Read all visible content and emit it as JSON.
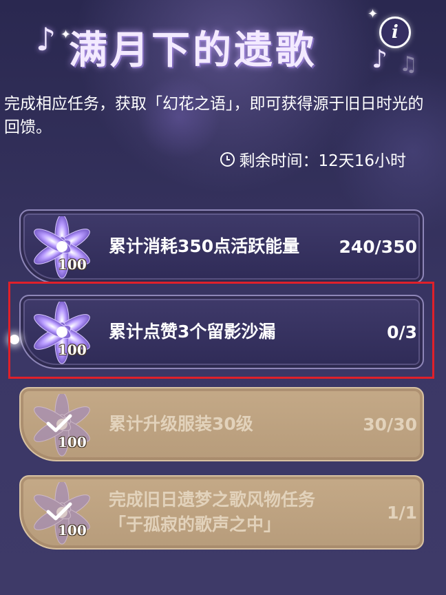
{
  "header": {
    "title": "满月下的遗歌",
    "info_label": "i"
  },
  "description": "完成相应任务，获取「幻花之语」，即可获得源于旧日时光的回馈。",
  "timer": {
    "label": "剩余时间：12天16小时"
  },
  "tasks": [
    {
      "title": "累计消耗350点活跃能量",
      "subtitle": "",
      "progress": "240/350",
      "reward_count": "100",
      "state": "in-progress"
    },
    {
      "title": "累计点赞3个留影沙漏",
      "subtitle": "",
      "progress": "0/3",
      "reward_count": "100",
      "state": "in-progress"
    },
    {
      "title": "累计升级服装30级",
      "subtitle": "",
      "progress": "30/30",
      "reward_count": "100",
      "state": "completed"
    },
    {
      "title": "完成旧日遗梦之歌风物任务",
      "subtitle": "「于孤寂的歌声之中」",
      "progress": "1/1",
      "reward_count": "100",
      "state": "completed"
    }
  ],
  "colors": {
    "accent_purple": "#8e86b8",
    "completed_gold": "#c4a987",
    "highlight_red": "#e0202a"
  }
}
